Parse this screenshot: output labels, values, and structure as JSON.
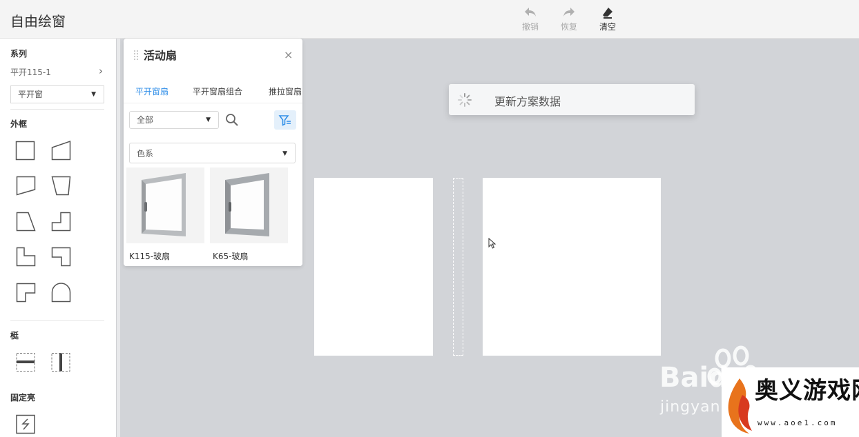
{
  "app": {
    "title": "自由绘窗"
  },
  "toolbar": {
    "undo_label": "撤销",
    "redo_label": "恢复",
    "clear_label": "清空"
  },
  "sidebar": {
    "series_title": "系列",
    "series_value": "平开115-1",
    "type_select": "平开窗",
    "frame_title": "外框",
    "frame_shapes": [
      "rectangle-icon",
      "trapezoid-right-icon",
      "pentagon-left-icon",
      "trapezoid-down-icon",
      "trapezoid-left-icon",
      "l-step-icon",
      "l-shape-icon",
      "l-shape-reverse-icon",
      "notch-shape-icon",
      "arch-icon"
    ],
    "mullion_title": "梃",
    "mullion_shapes": [
      "horizontal-mullion-icon",
      "vertical-mullion-icon"
    ],
    "fixed_title": "固定亮",
    "fixed_shapes": [
      "fixed-glass-icon"
    ]
  },
  "panel": {
    "title": "活动扇",
    "close_glyph": "×",
    "tabs": [
      {
        "label": "平开窗扇",
        "active": true
      },
      {
        "label": "平开窗扇组合",
        "active": false
      },
      {
        "label": "推拉窗扇",
        "active": false
      }
    ],
    "filter_select": "全部",
    "color_select": "色系",
    "products": [
      {
        "name": "K115-玻扇"
      },
      {
        "name": "K65-玻扇"
      }
    ]
  },
  "canvas": {
    "toast_message": "更新方案数据"
  },
  "watermarks": {
    "baidu": "Baidu",
    "baidu_sub": "jingyan",
    "site_name": "奥义游戏网",
    "site_url": "www.aoe1.com"
  },
  "colors": {
    "accent": "#2f8ee8",
    "canvas_bg": "#d2d4d8",
    "filter_btn_bg": "#e4f0fb"
  }
}
